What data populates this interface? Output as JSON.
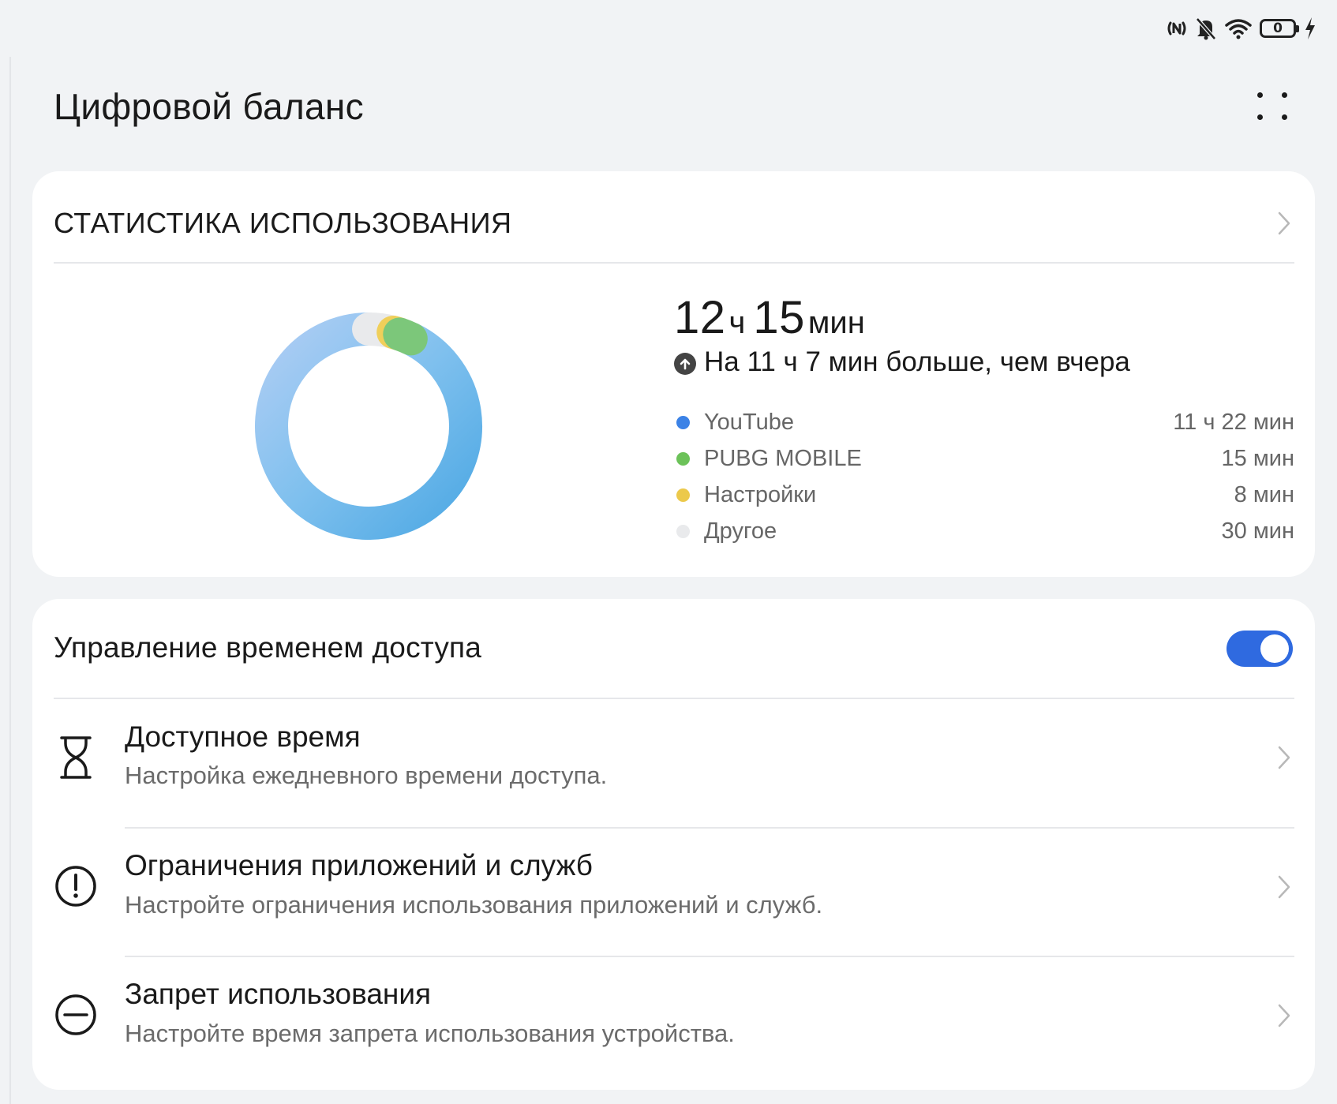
{
  "status_bar": {
    "icons": [
      "nfc-icon",
      "bell-off-icon",
      "wifi-icon",
      "battery-icon",
      "charging-bolt-icon"
    ],
    "battery_level": "0"
  },
  "header": {
    "title": "Цифровой баланс",
    "more_icon": "more-dots-icon"
  },
  "usage": {
    "section_title": "СТАТИСТИКА ИСПОЛЬЗОВАНИЯ",
    "total_hours": "12",
    "hours_unit": "ч",
    "total_minutes": "15",
    "minutes_unit": "мин",
    "comparison": "На 11 ч 7 мин больше, чем вчера",
    "legend": [
      {
        "name": "YouTube",
        "value": "11 ч 22 мин",
        "color": "#3b82e6"
      },
      {
        "name": "PUBG MOBILE",
        "value": "15 мин",
        "color": "#6cc259"
      },
      {
        "name": "Настройки",
        "value": "8 мин",
        "color": "#ecc94b"
      },
      {
        "name": "Другое",
        "value": "30 мин",
        "color": "#e9eaec"
      }
    ]
  },
  "chart_data": {
    "type": "pie",
    "style": "donut",
    "categories": [
      "YouTube",
      "PUBG MOBILE",
      "Настройки",
      "Другое"
    ],
    "values": [
      682,
      15,
      8,
      30
    ],
    "unit": "мин",
    "colors": [
      "#5aade6",
      "#7cc77a",
      "#f0cf5a",
      "#e9eaec"
    ]
  },
  "control": {
    "toggle_label": "Управление временем доступа",
    "toggle_on": true,
    "toggle_color": "#2f6ae0",
    "items": [
      {
        "icon": "hourglass-icon",
        "title": "Доступное время",
        "subtitle": "Настройка ежедневного времени доступа."
      },
      {
        "icon": "alert-circle-icon",
        "title": "Ограничения приложений и служб",
        "subtitle": "Настройте ограничения использования приложений и служб."
      },
      {
        "icon": "no-entry-icon",
        "title": "Запрет использования",
        "subtitle": "Настройте время запрета использования устройства."
      }
    ]
  }
}
